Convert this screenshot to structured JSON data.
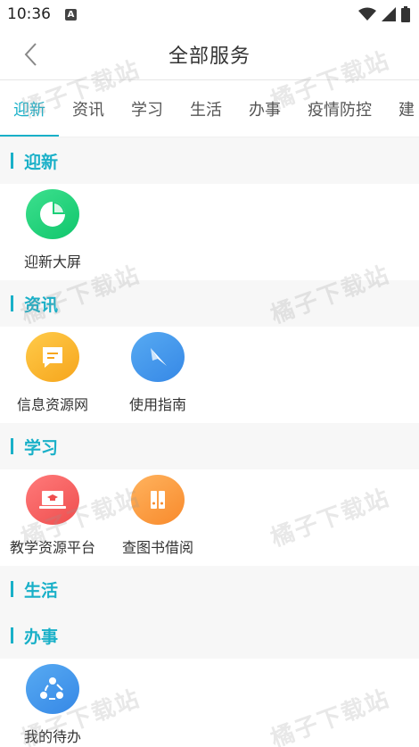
{
  "status": {
    "time": "10:36",
    "notif_glyph": "A"
  },
  "header": {
    "title": "全部服务"
  },
  "tabs": [
    {
      "label": "迎新"
    },
    {
      "label": "资讯"
    },
    {
      "label": "学习"
    },
    {
      "label": "生活"
    },
    {
      "label": "办事"
    },
    {
      "label": "疫情防控"
    },
    {
      "label": "建"
    }
  ],
  "sections": [
    {
      "title": "迎新",
      "items": [
        {
          "label": "迎新大屏",
          "icon": "pie-chart-icon",
          "color": "#1ccf78"
        }
      ]
    },
    {
      "title": "资讯",
      "items": [
        {
          "label": "信息资源网",
          "icon": "message-icon",
          "color": "#f9b42c"
        },
        {
          "label": "使用指南",
          "icon": "compass-icon",
          "color": "#4599ec"
        }
      ]
    },
    {
      "title": "学习",
      "items": [
        {
          "label": "教学资源平台",
          "icon": "laptop-graduation-icon",
          "color": "#f66161"
        },
        {
          "label": "查图书借阅",
          "icon": "books-icon",
          "color": "#fa9b40"
        }
      ]
    },
    {
      "title": "生活",
      "items": []
    },
    {
      "title": "办事",
      "items": [
        {
          "label": "我的待办",
          "icon": "share-people-icon",
          "color": "#4599ec"
        }
      ]
    }
  ],
  "watermark": "橘子下载站",
  "colors": {
    "accent": "#19b0c8"
  }
}
